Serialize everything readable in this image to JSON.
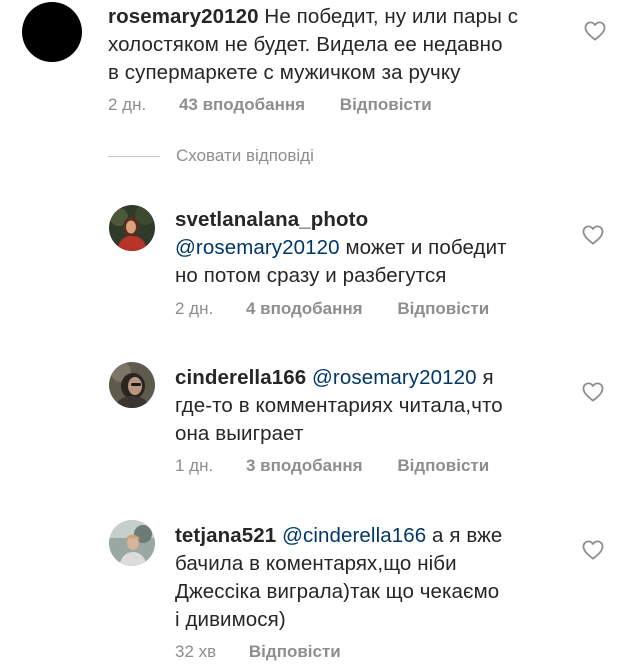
{
  "comments": [
    {
      "username": "rosemary20120",
      "text_line1": " Не победит, ну или пары с",
      "text_line2": "холостяком не будет. Видела ее недавно",
      "text_line3": "в супермаркете с мужичком за ручку",
      "time": "2 дн.",
      "likes": "43 вподобання",
      "reply": "Відповісти"
    }
  ],
  "hide_replies_label": "Сховати відповіді",
  "replies": [
    {
      "username": "svetlanalana_photo",
      "mention": "@rosemary20120",
      "text_line1": " может и победит",
      "text_line2": "но потом сразу и разбегутся",
      "time": "2 дн.",
      "likes": "4 вподобання",
      "reply": "Відповісти"
    },
    {
      "username": "cinderella166",
      "mention": "@rosemary20120",
      "text_line1": " я",
      "text_line2": "где-то в комментариях читала,что",
      "text_line3": "она выиграет",
      "time": "1 дн.",
      "likes": "3 вподобання",
      "reply": "Відповісти"
    },
    {
      "username": "tetjana521",
      "mention": "@cinderella166",
      "text_line1": " а я вже",
      "text_line2": "бачила в коментарях,що ніби",
      "text_line3": "Джессіка виграла)так що чекаємо",
      "text_line4": "і дивимося)",
      "time": "32 хв",
      "reply": "Відповісти"
    }
  ],
  "icons": {
    "like": "heart-outline-icon"
  },
  "colors": {
    "text": "#262626",
    "meta": "#8e8e8e",
    "mention": "#00376b",
    "avatar_placeholder": "#000000"
  }
}
